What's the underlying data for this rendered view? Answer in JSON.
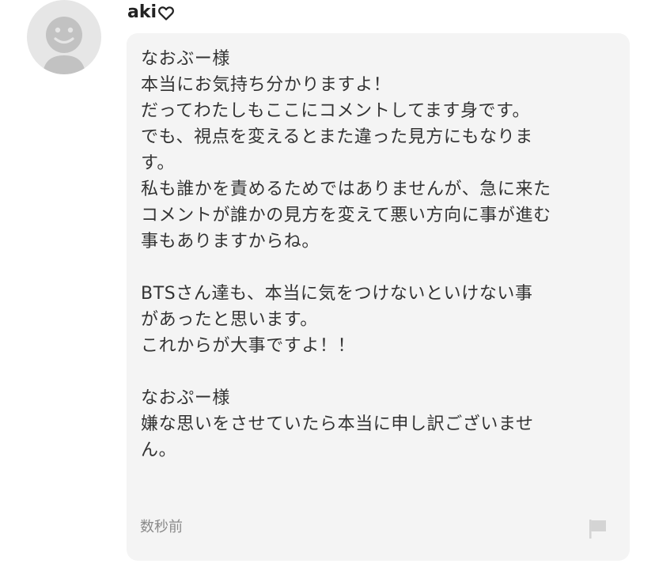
{
  "comment": {
    "username": "aki",
    "username_icon": "heart-outline-icon",
    "avatar_icon": "default-avatar-icon",
    "body": "なおぶー様\n本当にお気持ち分かりますよ！\nだってわたしもここにコメントしてます身です。\nでも、視点を変えるとまた違った見方にもなりま\nす。\n私も誰かを責めるためではありませんが、急に来た\nコメントが誰かの見方を変えて悪い方向に事が進む\n事もありますからね。\n\nBTSさん達も、本当に気をつけないといけない事\nがあったと思います。\nこれからが大事ですよ！！\n\nなおぷー様\n嫌な思いをさせていたら本当に申し訳ございませ\nん。",
    "timestamp": "数秒前",
    "report_icon": "flag-icon"
  },
  "colors": {
    "bubble_background": "#f4f4f4",
    "text": "#333333",
    "timestamp": "#8a8a8a",
    "avatar_background": "#e6e6e6",
    "avatar_figure": "#c2c2c2",
    "flag": "#d4d4d4"
  }
}
